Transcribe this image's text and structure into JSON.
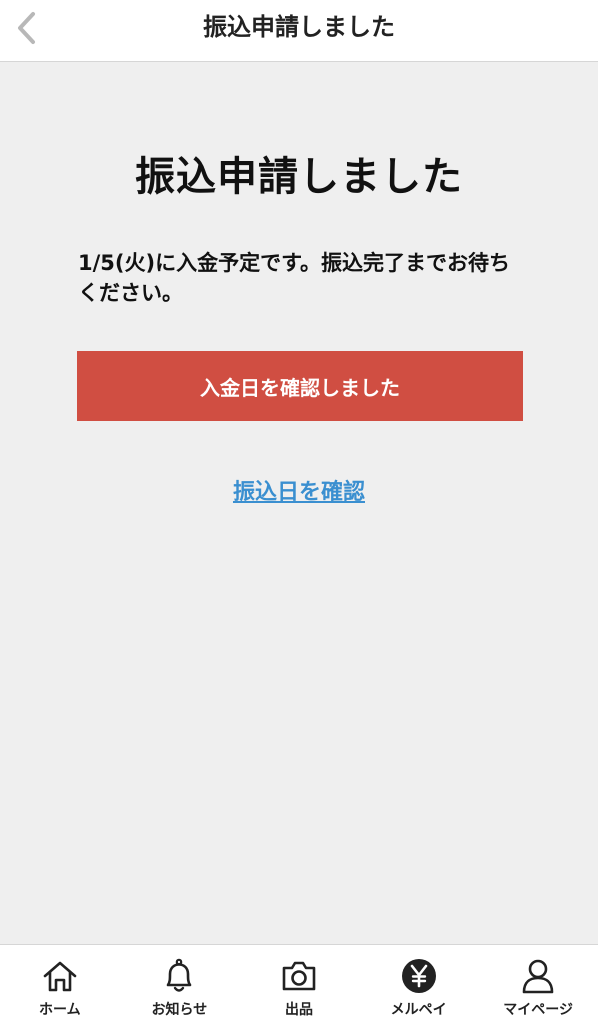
{
  "nav": {
    "title": "振込申請しました"
  },
  "main": {
    "title": "振込申請しました",
    "message": "1/5(火)に入金予定です。振込完了までお待ちください。",
    "confirm_button": "入金日を確認しました",
    "check_link": "振込日を確認"
  },
  "tabs": [
    {
      "label": "ホーム",
      "icon": "home-icon"
    },
    {
      "label": "お知らせ",
      "icon": "bell-icon"
    },
    {
      "label": "出品",
      "icon": "camera-icon"
    },
    {
      "label": "メルペイ",
      "icon": "yen-icon"
    },
    {
      "label": "マイページ",
      "icon": "person-icon"
    }
  ],
  "colors": {
    "accent": "#d04e42",
    "link": "#3a8fd0",
    "background": "#efefef"
  }
}
